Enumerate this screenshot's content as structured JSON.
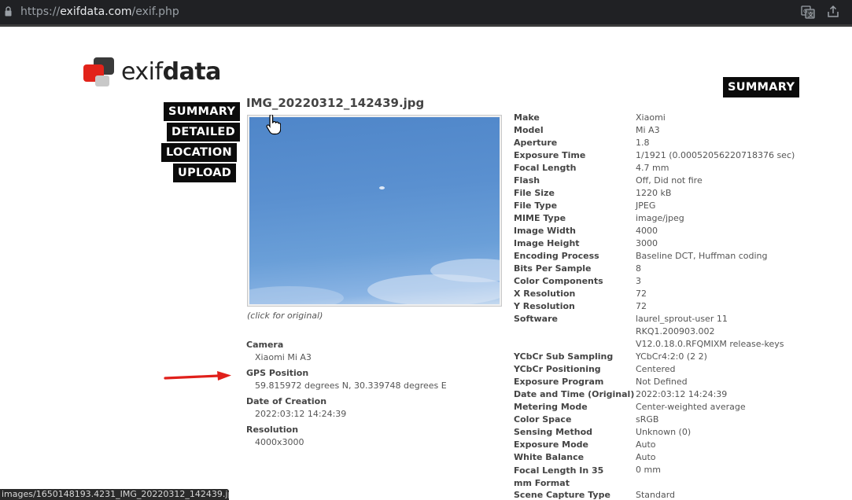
{
  "browser": {
    "url_prefix": "https://",
    "url_host": "exifdata.com",
    "url_path": "/exif.php"
  },
  "logo": {
    "prefix": "exif",
    "suffix": "data"
  },
  "nav": {
    "summary": "SUMMARY",
    "detailed": "DETAILED",
    "location": "LOCATION",
    "upload": "UPLOAD"
  },
  "summary_badge": "SUMMARY",
  "filename": "IMG_20220312_142439.jpg",
  "caption": "(click for original)",
  "summary": {
    "camera_label": "Camera",
    "camera_value": "Xiaomi Mi A3",
    "gps_label": "GPS Position",
    "gps_value": "59.815972 degrees N, 30.339748 degrees E",
    "date_label": "Date of Creation",
    "date_value": "2022:03:12 14:24:39",
    "res_label": "Resolution",
    "res_value": "4000x3000"
  },
  "table": [
    {
      "key": "Make",
      "value": "Xiaomi"
    },
    {
      "key": "Model",
      "value": "Mi A3"
    },
    {
      "key": "Aperture",
      "value": "1.8"
    },
    {
      "key": "Exposure Time",
      "value": "1/1921 (0.00052056220718376 sec)"
    },
    {
      "key": "Focal Length",
      "value": "4.7 mm"
    },
    {
      "key": "Flash",
      "value": "Off, Did not fire"
    },
    {
      "key": "File Size",
      "value": "1220 kB"
    },
    {
      "key": "File Type",
      "value": "JPEG"
    },
    {
      "key": "MIME Type",
      "value": "image/jpeg"
    },
    {
      "key": "Image Width",
      "value": "4000"
    },
    {
      "key": "Image Height",
      "value": "3000"
    },
    {
      "key": "Encoding Process",
      "value": "Baseline DCT, Huffman coding"
    },
    {
      "key": "Bits Per Sample",
      "value": "8"
    },
    {
      "key": "Color Components",
      "value": "3"
    },
    {
      "key": "X Resolution",
      "value": "72"
    },
    {
      "key": "Y Resolution",
      "value": "72"
    },
    {
      "key": "Software",
      "value": "laurel_sprout-user 11"
    },
    {
      "key": "",
      "value": "RKQ1.200903.002"
    },
    {
      "key": "",
      "value": "V12.0.18.0.RFQMIXM release-keys"
    },
    {
      "key": "YCbCr Sub Sampling",
      "value": "YCbCr4:2:0 (2 2)"
    },
    {
      "key": "YCbCr Positioning",
      "value": "Centered"
    },
    {
      "key": "Exposure Program",
      "value": "Not Defined"
    },
    {
      "key": "Date and Time (Original)",
      "value": "2022:03:12 14:24:39"
    },
    {
      "key": "Metering Mode",
      "value": "Center-weighted average"
    },
    {
      "key": "Color Space",
      "value": "sRGB"
    },
    {
      "key": "Sensing Method",
      "value": "Unknown (0)"
    },
    {
      "key": "Exposure Mode",
      "value": "Auto"
    },
    {
      "key": "White Balance",
      "value": "Auto"
    },
    {
      "key": "Focal Length In 35 mm Format",
      "value": "0 mm"
    },
    {
      "key": "Scene Capture Type",
      "value": "Standard"
    }
  ],
  "status_url": "images/1650148193.4231_IMG_20220312_142439.jpg",
  "colors": {
    "nav_bg": "#0b0b0b",
    "logo_red": "#e2231a",
    "arrow_red": "#e0201b"
  }
}
